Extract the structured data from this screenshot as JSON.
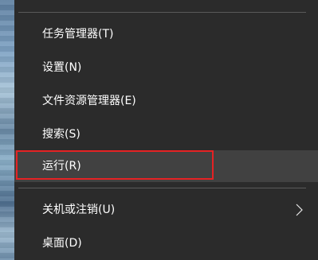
{
  "menu": {
    "items": [
      {
        "label": "任务管理器(T)"
      },
      {
        "label": "设置(N)"
      },
      {
        "label": "文件资源管理器(E)"
      },
      {
        "label": "搜索(S)"
      },
      {
        "label": "运行(R)",
        "highlighted": true
      },
      {
        "label": "关机或注销(U)",
        "has_submenu": true
      },
      {
        "label": "桌面(D)"
      }
    ],
    "highlight_color": "#e52224",
    "background_color": "#2b2b2b",
    "hover_color": "#414141",
    "text_color": "#ffffff"
  }
}
